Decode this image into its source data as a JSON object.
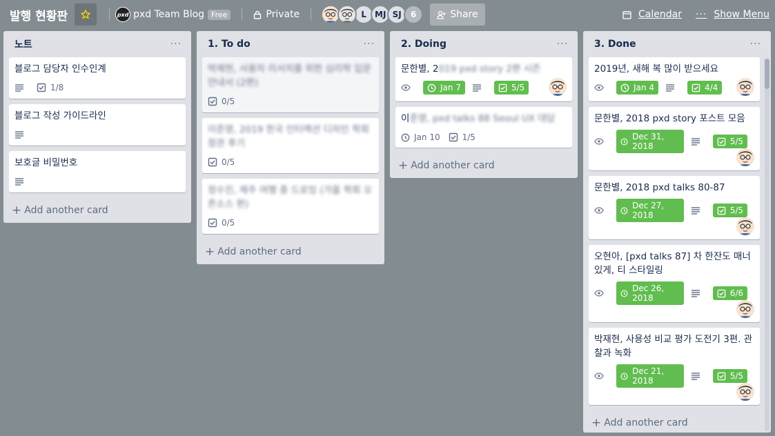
{
  "header": {
    "board_title": "발행 현황판",
    "team_name": "pxd Team Blog",
    "team_logo": "pxd",
    "plan_badge": "Free",
    "visibility": "Private",
    "members": [
      "",
      "",
      "L",
      "MJ",
      "SJ",
      "6"
    ],
    "share": "Share",
    "calendar": "Calendar",
    "show_menu": "Show Menu"
  },
  "lists": [
    {
      "title": "노트",
      "menu": "···",
      "cards": [
        {
          "title": "블로그 담당자 인수인계",
          "checklist": "1/8"
        },
        {
          "title": "블로그 작성 가이드라인"
        },
        {
          "title": "보호글 비밀번호"
        }
      ],
      "add": "Add another card"
    },
    {
      "title": "1. To do",
      "menu": "···",
      "cards": [
        {
          "title": "박재현, 사용자 리서치를 위한 심리학 입문 안내서 (2편)",
          "checklist": "0/5"
        },
        {
          "title": "이준영, 2019 한국 인터랙션 디자인 학회 참관 후기",
          "checklist": "0/5"
        },
        {
          "title": "정수진, 제주 여행 중 드로잉 (가을 학회 오픈소스 편)",
          "checklist": "0/5"
        }
      ],
      "add": "Add another card"
    },
    {
      "title": "2. Doing",
      "menu": "···",
      "cards": [
        {
          "title_a": "문한별, 2",
          "title_b": "019 pxd story 2편 시즌",
          "due": "Jan 7",
          "checklist": "5/5"
        },
        {
          "title_a": "이",
          "title_b": "준영, pxd talks 88 Seoul UX 대담",
          "due": "Jan 10",
          "checklist": "1/5"
        }
      ],
      "add": "Add another card"
    },
    {
      "title": "3. Done",
      "menu": "···",
      "cards": [
        {
          "title": "2019년, 새해 복 많이 받으세요",
          "due": "Jan 4",
          "checklist": "4/4"
        },
        {
          "title": "문한별, 2018 pxd story 포스트 모음",
          "due": "Dec 31, 2018",
          "checklist": "5/5"
        },
        {
          "title": "문한별, 2018 pxd talks 80-87",
          "due": "Dec 27, 2018",
          "checklist": "5/5"
        },
        {
          "title": "오현아, [pxd talks 87] 차 한잔도 매너있게, 티 스타일링",
          "due": "Dec 26, 2018",
          "checklist": "6/6"
        },
        {
          "title": "박재현, 사용성 비교 평가 도전기 3편. 관찰과 녹화",
          "due": "Dec 21, 2018",
          "checklist": "5/5"
        }
      ],
      "add": "Add another card"
    }
  ],
  "colors": {
    "board_bg": "#838c91",
    "list_bg": "#dfe1e6",
    "label_green": "#61bd4f",
    "star": "#f2d600"
  }
}
